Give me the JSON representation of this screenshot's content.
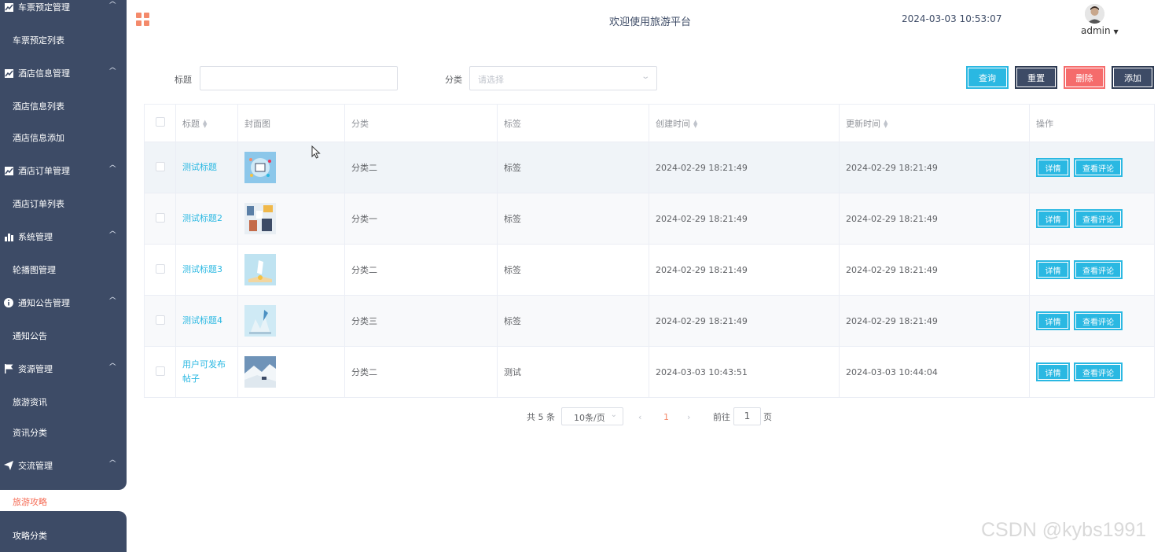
{
  "sidebar": {
    "items": [
      {
        "type": "group",
        "label": "车票预定管理",
        "icon": "chart-icon"
      },
      {
        "type": "sub",
        "label": "车票预定列表"
      },
      {
        "type": "group",
        "label": "酒店信息管理",
        "icon": "chart-icon"
      },
      {
        "type": "sub",
        "label": "酒店信息列表"
      },
      {
        "type": "sub",
        "label": "酒店信息添加"
      },
      {
        "type": "group",
        "label": "酒店订单管理",
        "icon": "chart-icon"
      },
      {
        "type": "sub",
        "label": "酒店订单列表"
      },
      {
        "type": "group",
        "label": "系统管理",
        "icon": "bar-chart-icon"
      },
      {
        "type": "sub",
        "label": "轮播图管理"
      },
      {
        "type": "group",
        "label": "通知公告管理",
        "icon": "info-icon"
      },
      {
        "type": "sub",
        "label": "通知公告"
      },
      {
        "type": "group",
        "label": "资源管理",
        "icon": "flag-icon"
      },
      {
        "type": "sub",
        "label": "旅游资讯"
      },
      {
        "type": "sub",
        "label": "资讯分类"
      },
      {
        "type": "group",
        "label": "交流管理",
        "icon": "send-icon"
      },
      {
        "type": "sub",
        "label": "旅游攻略",
        "active": true
      },
      {
        "type": "sub",
        "label": "攻略分类"
      }
    ]
  },
  "header": {
    "title": "欢迎使用旅游平台",
    "datetime": "2024-03-03 10:53:07",
    "username": "admin"
  },
  "search": {
    "title_label": "标题",
    "title_value": "",
    "category_label": "分类",
    "category_placeholder": "请选择",
    "query_btn": "查询",
    "reset_btn": "重置",
    "delete_btn": "删除",
    "add_btn": "添加"
  },
  "table": {
    "columns": [
      "标题",
      "封面图",
      "分类",
      "标签",
      "创建时间",
      "更新时间",
      "操作"
    ],
    "rows": [
      {
        "title": "测试标题",
        "category": "分类二",
        "tag": "标签",
        "created": "2024-02-29 18:21:49",
        "updated": "2024-02-29 18:21:49"
      },
      {
        "title": "测试标题2",
        "category": "分类一",
        "tag": "标签",
        "created": "2024-02-29 18:21:49",
        "updated": "2024-02-29 18:21:49"
      },
      {
        "title": "测试标题3",
        "category": "分类二",
        "tag": "标签",
        "created": "2024-02-29 18:21:49",
        "updated": "2024-02-29 18:21:49"
      },
      {
        "title": "测试标题4",
        "category": "分类三",
        "tag": "标签",
        "created": "2024-02-29 18:21:49",
        "updated": "2024-02-29 18:21:49"
      },
      {
        "title": "用户可发布帖子",
        "category": "分类二",
        "tag": "测试",
        "created": "2024-03-03 10:43:51",
        "updated": "2024-03-03 10:44:04"
      }
    ],
    "detail_btn": "详情",
    "comments_btn": "查看评论"
  },
  "pagination": {
    "total_text": "共 5 条",
    "page_size": "10条/页",
    "current_page": "1",
    "goto_label": "前往",
    "goto_value": "1",
    "page_suffix": "页"
  },
  "watermark": "CSDN @kybs1991",
  "colors": {
    "sidebar_bg": "#3d4b66",
    "accent": "#2ab8e2",
    "danger": "#f56c6c",
    "active_menu": "#f56c55"
  }
}
